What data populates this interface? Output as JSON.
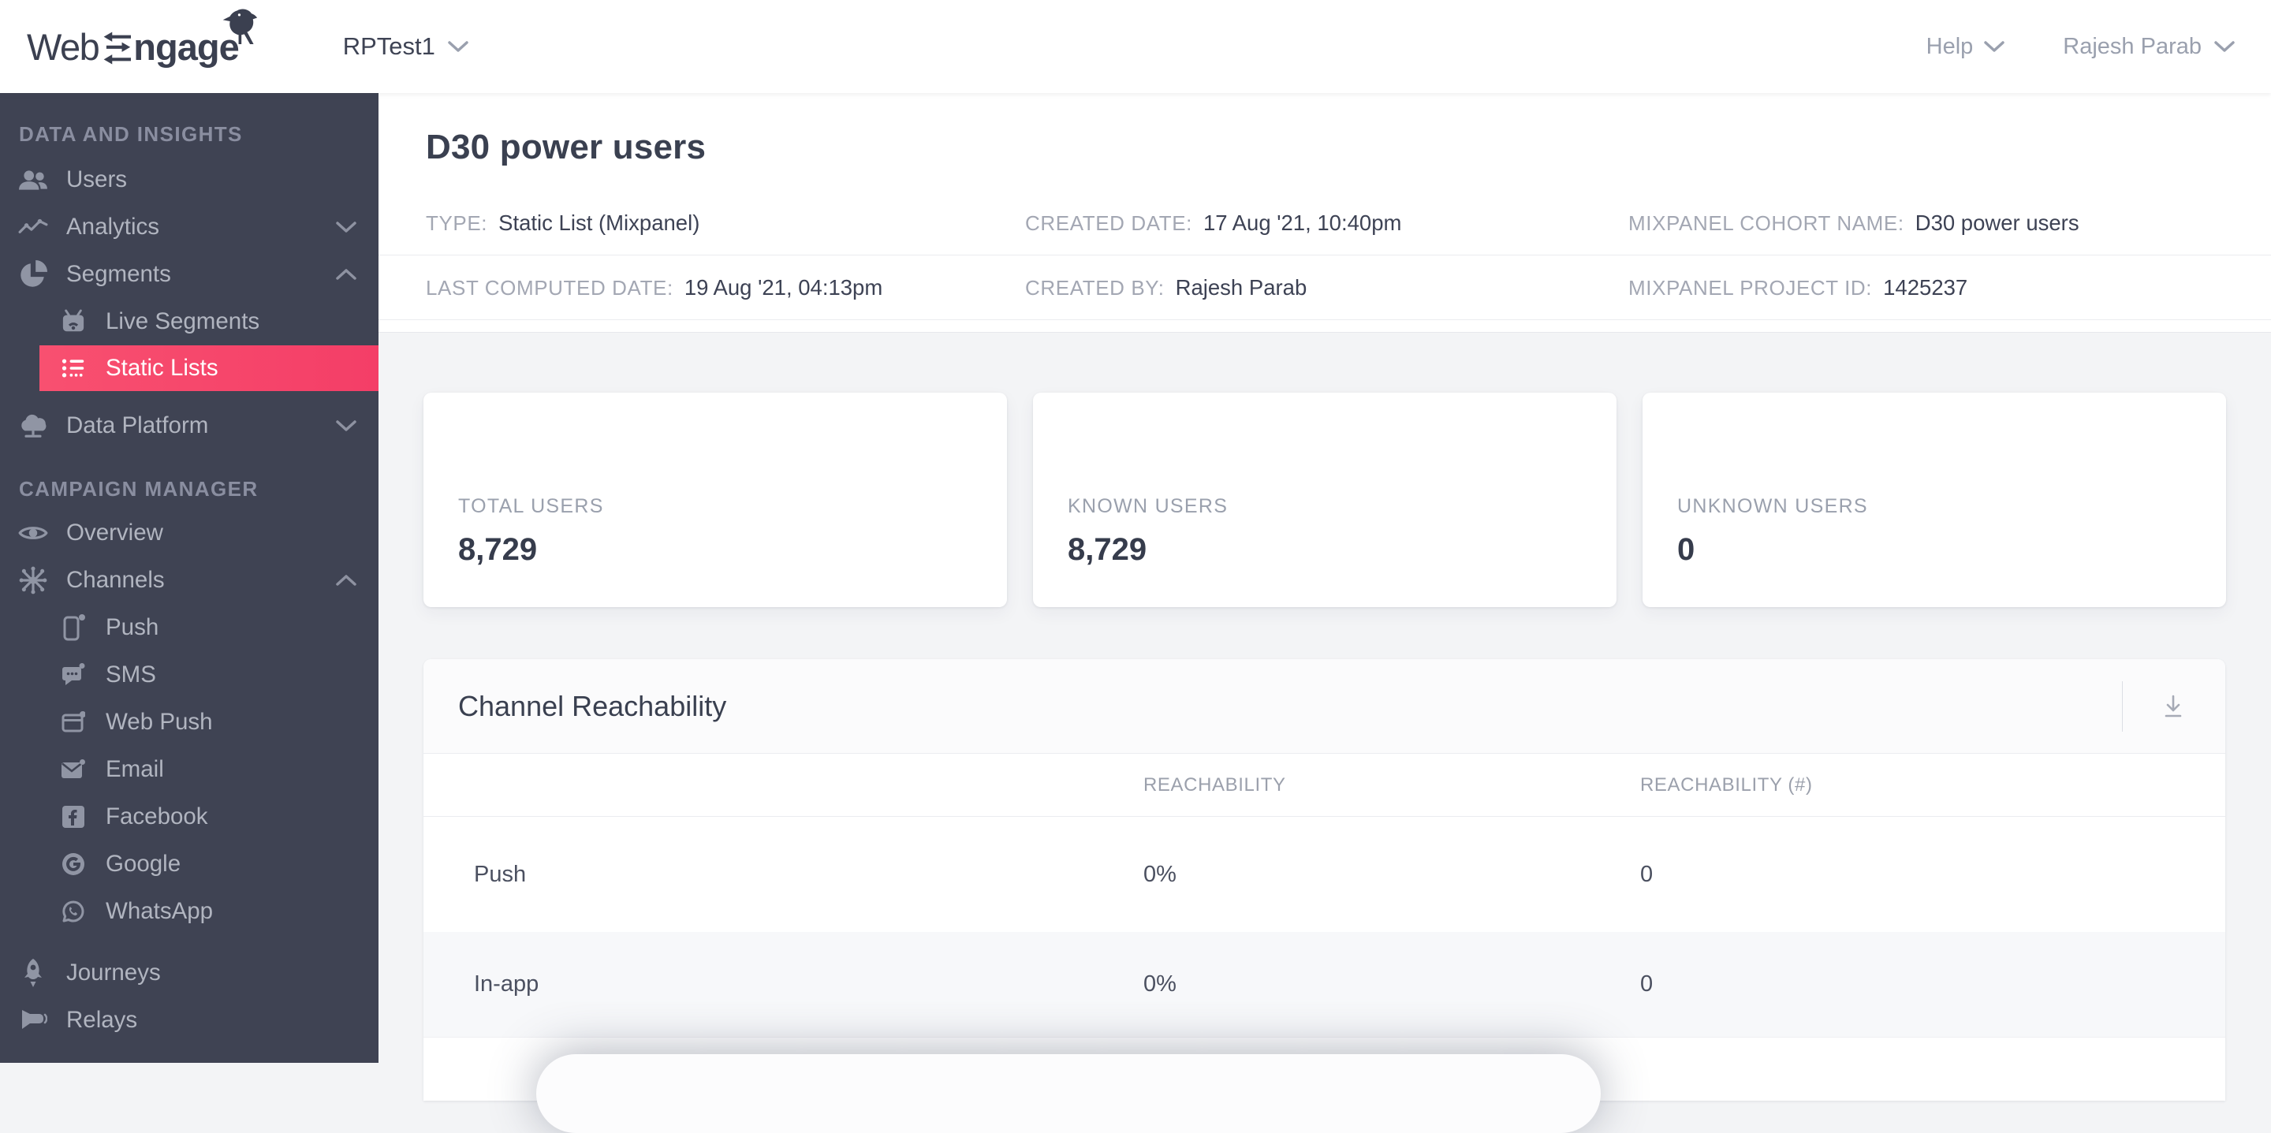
{
  "colors": {
    "accent_pink": "#f6496d",
    "sidebar_bg": "#3f4353",
    "page_bg": "#f3f4f6",
    "text_dark": "#3a4050",
    "text_gray": "#9ba0ac"
  },
  "topbar": {
    "logo_part1": "Web",
    "logo_part2": "ngage",
    "project_name": "RPTest1",
    "help_label": "Help",
    "user_name": "Rajesh Parab"
  },
  "sidebar": {
    "sections": [
      {
        "header": "DATA AND INSIGHTS",
        "items": [
          {
            "label": "Users"
          },
          {
            "label": "Analytics"
          },
          {
            "label": "Segments"
          },
          {
            "label": "Live Segments"
          },
          {
            "label": "Static Lists"
          },
          {
            "label": "Data Platform"
          }
        ]
      },
      {
        "header": "CAMPAIGN MANAGER",
        "items": [
          {
            "label": "Overview"
          },
          {
            "label": "Channels"
          },
          {
            "label": "Push"
          },
          {
            "label": "SMS"
          },
          {
            "label": "Web Push"
          },
          {
            "label": "Email"
          },
          {
            "label": "Facebook"
          },
          {
            "label": "Google"
          },
          {
            "label": "WhatsApp"
          },
          {
            "label": "Journeys"
          },
          {
            "label": "Relays"
          }
        ]
      }
    ]
  },
  "main": {
    "title": "D30 power users",
    "meta": {
      "row1": [
        {
          "label": "TYPE:",
          "value": "Static List (Mixpanel)"
        },
        {
          "label": "CREATED DATE:",
          "value": "17 Aug '21, 10:40pm"
        },
        {
          "label": "MIXPANEL COHORT NAME:",
          "value": "D30 power users"
        }
      ],
      "row2": [
        {
          "label": "LAST COMPUTED DATE:",
          "value": "19 Aug '21, 04:13pm"
        },
        {
          "label": "CREATED BY:",
          "value": "Rajesh Parab"
        },
        {
          "label": "MIXPANEL PROJECT ID:",
          "value": "1425237"
        }
      ]
    },
    "stats": [
      {
        "label": "TOTAL USERS",
        "value": "8,729"
      },
      {
        "label": "KNOWN USERS",
        "value": "8,729"
      },
      {
        "label": "UNKNOWN USERS",
        "value": "0"
      }
    ],
    "reachability": {
      "title": "Channel Reachability",
      "columns": [
        "REACHABILITY",
        "REACHABILITY (#)"
      ],
      "rows": [
        {
          "channel": "Push",
          "reachability": "0%",
          "count": "0"
        },
        {
          "channel": "In-app",
          "reachability": "0%",
          "count": "0"
        }
      ]
    }
  }
}
